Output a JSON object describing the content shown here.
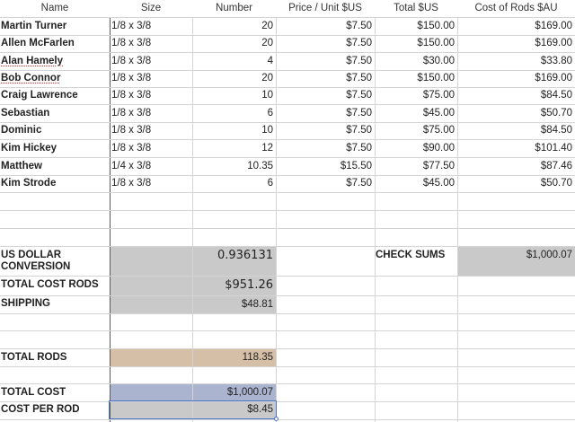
{
  "columns": [
    "Name",
    "Size",
    "Number",
    "Price / Unit $US",
    "Total $US",
    "Cost of Rods $AU"
  ],
  "rows": [
    {
      "name": "Martin Turner",
      "size": "1/8 x 3/8",
      "number": "20",
      "price": "$7.50",
      "total": "$150.00",
      "cost": "$169.00"
    },
    {
      "name": "Allen McFarlen",
      "size": "1/8 x 3/8",
      "number": "20",
      "price": "$7.50",
      "total": "$150.00",
      "cost": "$169.00"
    },
    {
      "name": "Alan Hamely",
      "size": "1/8 x 3/8",
      "number": "4",
      "price": "$7.50",
      "total": "$30.00",
      "cost": "$33.80"
    },
    {
      "name": "Bob Connor",
      "size": "1/8 x 3/8",
      "number": "20",
      "price": "$7.50",
      "total": "$150.00",
      "cost": "$169.00"
    },
    {
      "name": "Craig Lawrence",
      "size": "1/8 x 3/8",
      "number": "10",
      "price": "$7.50",
      "total": "$75.00",
      "cost": "$84.50"
    },
    {
      "name": "Sebastian",
      "size": "1/8 x 3/8",
      "number": "6",
      "price": "$7.50",
      "total": "$45.00",
      "cost": "$50.70"
    },
    {
      "name": "Dominic",
      "size": "1/8 x 3/8",
      "number": "10",
      "price": "$7.50",
      "total": "$75.00",
      "cost": "$84.50"
    },
    {
      "name": "Kim Hickey",
      "size": "1/8 x 3/8",
      "number": "12",
      "price": "$7.50",
      "total": "$90.00",
      "cost": "$101.40"
    },
    {
      "name": "Matthew",
      "size": "1/4 x 3/8",
      "number": "10.35",
      "price": "$15.50",
      "total": "$77.50",
      "cost": "$87.46"
    },
    {
      "name": "Kim Strode",
      "size": "1/8 x 3/8",
      "number": "6",
      "price": "$7.50",
      "total": "$45.00",
      "cost": "$50.70"
    }
  ],
  "summary": {
    "conversion_label": "US DOLLAR CONVERSION",
    "conversion_value": "0.936131",
    "check_sums_label": "CHECK SUMS",
    "check_sums_value": "$1,000.07",
    "total_cost_rods_label": "TOTAL COST RODS",
    "total_cost_rods_value": "$951.26",
    "shipping_label": "SHIPPING",
    "shipping_value": "$48.81",
    "total_rods_label": "TOTAL RODS",
    "total_rods_value": "118.35",
    "total_cost_label": "TOTAL COST",
    "total_cost_value": "$1,000.07",
    "cost_per_rod_label": "COST PER ROD",
    "cost_per_rod_value": "$8.45"
  },
  "colors": {
    "gray_fill": "#c9c9c9",
    "tan_fill": "#d5bfa6",
    "blue_fill": "#aab4cf",
    "selection": "#4a74c9",
    "grid": "#d4d4d4"
  }
}
